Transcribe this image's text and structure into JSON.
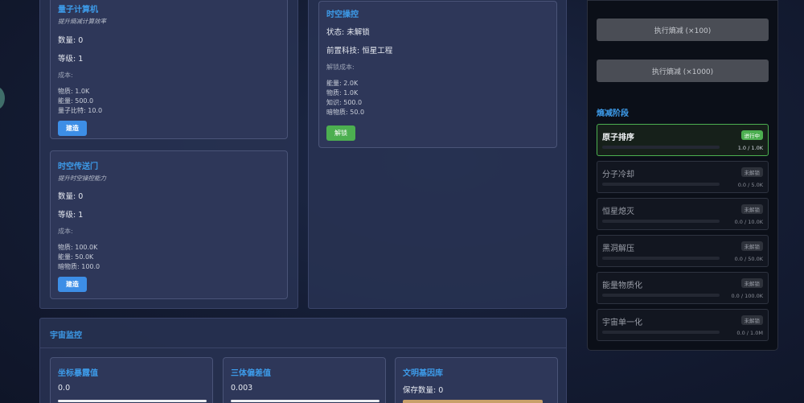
{
  "tech_panel": {
    "quantum": {
      "title": "量子计算机",
      "subtitle": "提升熵减计算效率",
      "count": "数量: 0",
      "level": "等级: 1",
      "cost_label": "成本:",
      "costs": [
        "物质: 1.0K",
        "能量: 500.0",
        "量子比特: 10.0"
      ],
      "button": "建造"
    },
    "portal": {
      "title": "时空传送门",
      "subtitle": "提升时空操控能力",
      "count": "数量: 0",
      "level": "等级: 1",
      "cost_label": "成本:",
      "costs": [
        "物质: 100.0K",
        "能量: 50.0K",
        "暗物质: 100.0"
      ],
      "button": "建造"
    }
  },
  "research_panel": {
    "spacetime": {
      "title": "时空操控",
      "status": "状态: 未解锁",
      "prereq": "前置科技: 恒星工程",
      "cost_label": "解锁成本:",
      "costs": [
        "能量: 2.0K",
        "物质: 1.0K",
        "知识: 500.0",
        "暗物质: 50.0"
      ],
      "button": "解锁"
    }
  },
  "monitor": {
    "title": "宇宙监控",
    "cards": [
      {
        "title": "坐标暴露值",
        "value": "0.0"
      },
      {
        "title": "三体偏差值",
        "value": "0.003"
      },
      {
        "title": "文明基因库",
        "value": "保存数量: 0"
      }
    ]
  },
  "entropy": {
    "exec_100": "执行熵减 (×100)",
    "exec_1000": "执行熵减 (×1000)",
    "stages_title": "熵减阶段",
    "stages": [
      {
        "name": "原子排序",
        "badge": "进行中",
        "progress": "1.0 / 1.0K",
        "active": true
      },
      {
        "name": "分子冷却",
        "badge": "未解锁",
        "progress": "0.0 / 5.0K"
      },
      {
        "name": "恒星熄灭",
        "badge": "未解锁",
        "progress": "0.0 / 10.0K"
      },
      {
        "name": "黑洞解压",
        "badge": "未解锁",
        "progress": "0.0 / 50.0K"
      },
      {
        "name": "能量物质化",
        "badge": "未解锁",
        "progress": "0.0 / 100.0K"
      },
      {
        "name": "宇宙单一化",
        "badge": "未解锁",
        "progress": "0.0 / 1.0M"
      }
    ]
  },
  "colors": {
    "accent": "#3d9be9",
    "active_green": "#4caf50",
    "button_blue": "#3d8ee6"
  }
}
